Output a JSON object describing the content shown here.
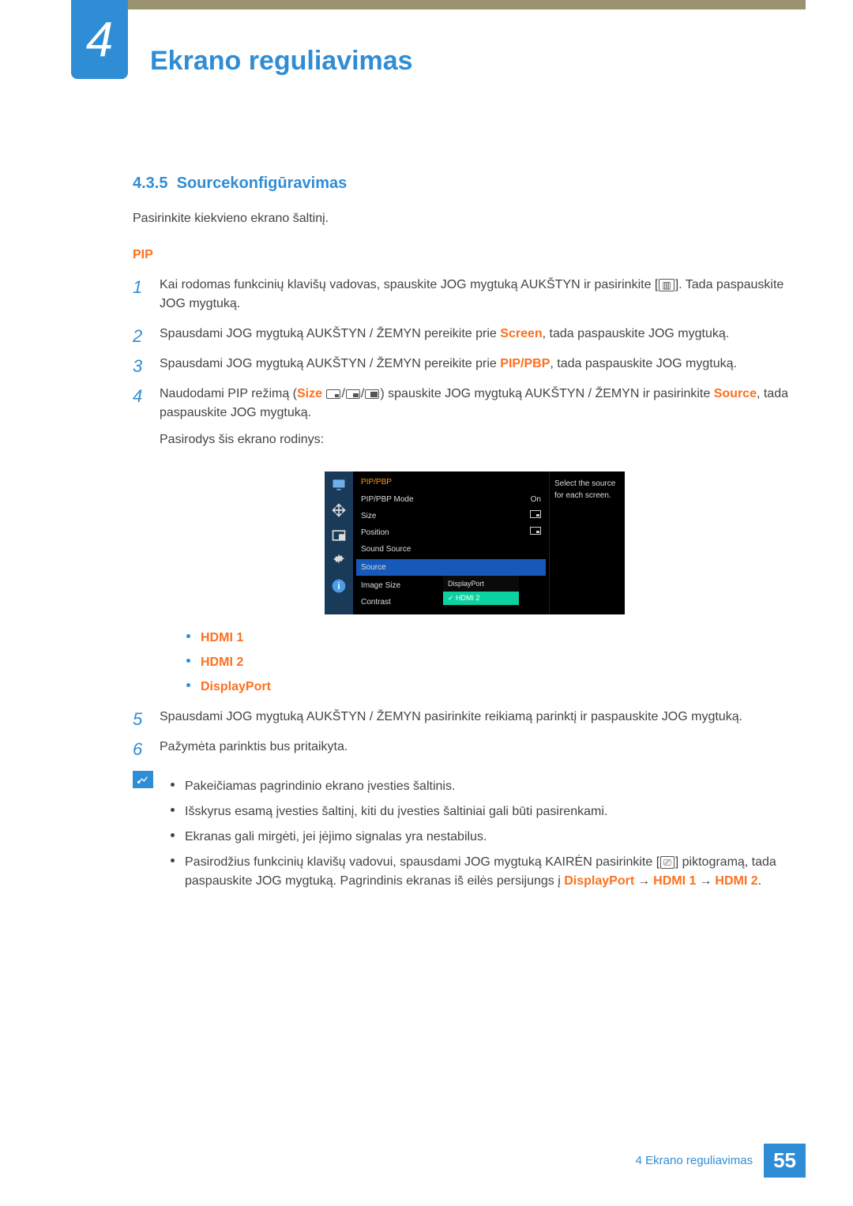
{
  "chapter": {
    "number": "4",
    "title": "Ekrano reguliavimas"
  },
  "section": {
    "id": "4.3.5",
    "heading": "Sourcekonfigūravimas"
  },
  "intro": "Pasirinkite kiekvieno ekrano šaltinį.",
  "subheading": "PIP",
  "steps": {
    "s1a": "Kai rodomas funkcinių klavišų vadovas, spauskite JOG mygtuką AUKŠTYN ir pasirinkite [",
    "s1b": "]. Tada paspauskite JOG mygtuką.",
    "s2a": "Spausdami JOG mygtuką AUKŠTYN / ŽEMYN pereikite prie ",
    "s2kw": "Screen",
    "s2b": ", tada paspauskite JOG mygtuką.",
    "s3a": "Spausdami JOG mygtuką AUKŠTYN / ŽEMYN pereikite prie ",
    "s3kw": "PIP/PBP",
    "s3b": ", tada paspauskite JOG mygtuką.",
    "s4a": "Naudodami PIP režimą (",
    "s4size": "Size",
    "s4b": ") spauskite JOG mygtuką AUKŠTYN / ŽEMYN ir pasirinkite ",
    "s4kw": "Source",
    "s4c": ", tada paspauskite JOG mygtuką.",
    "s4d": "Pasirodys šis ekrano rodinys:",
    "s5": "Spausdami JOG mygtuką AUKŠTYN / ŽEMYN pasirinkite reikiamą parinktį ir paspauskite JOG mygtuką.",
    "s6": "Pažymėta parinktis bus pritaikyta."
  },
  "osd": {
    "title": "PIP/PBP",
    "items": [
      "PIP/PBP Mode",
      "Size",
      "Position",
      "Sound Source",
      "Source",
      "Image Size",
      "Contrast"
    ],
    "modeVal": "On",
    "dropdown": [
      "DisplayPort",
      "HDMI 2"
    ],
    "help": "Select the source for each screen."
  },
  "sourceOptions": [
    "HDMI 1",
    "HDMI 2",
    "DisplayPort"
  ],
  "notes": {
    "n1": "Pakeičiamas pagrindinio ekrano įvesties šaltinis.",
    "n2": "Išskyrus esamą įvesties šaltinį, kiti du įvesties šaltiniai gali būti pasirenkami.",
    "n3": "Ekranas gali mirgėti, jei įėjimo signalas yra nestabilus.",
    "n4a": "Pasirodžius funkcinių klavišų vadovui, spausdami JOG mygtuką KAIRĖN pasirinkite [",
    "n4b": "] piktogramą, tada paspauskite JOG mygtuką. Pagrindinis ekranas iš eilės persijungs į ",
    "seq1": "DisplayPort",
    "seq2": "HDMI 1",
    "seq3": "HDMI 2"
  },
  "footer": {
    "text": "4 Ekrano reguliavimas",
    "page": "55"
  }
}
